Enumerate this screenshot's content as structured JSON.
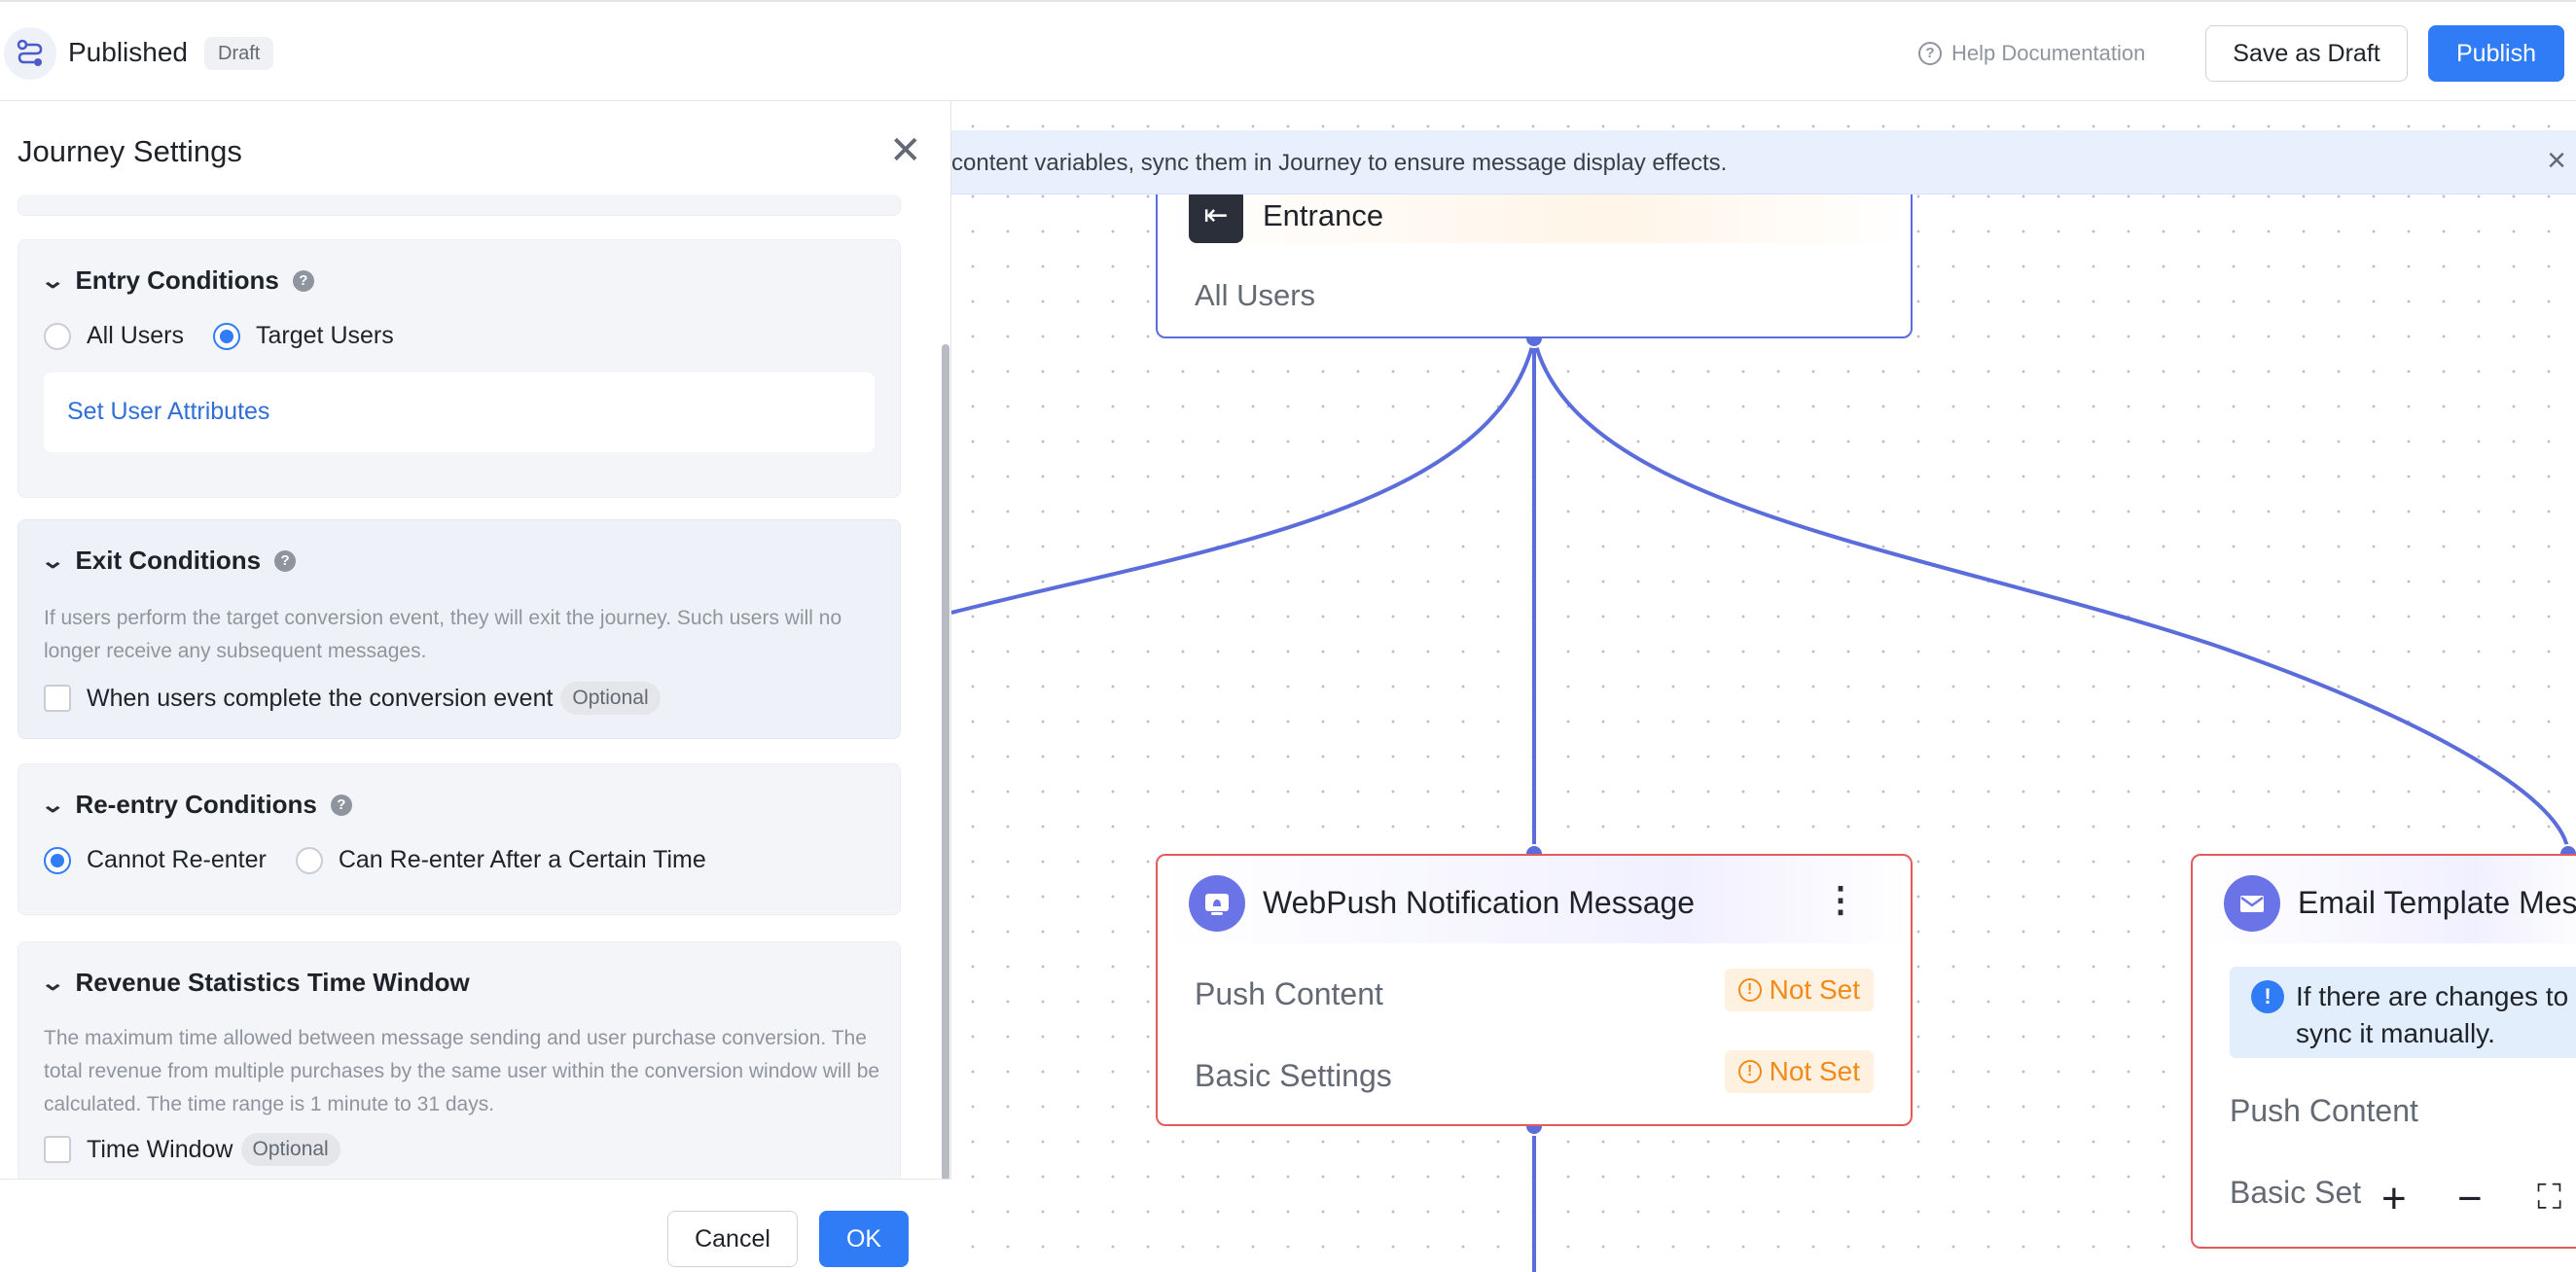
{
  "header": {
    "title": "Published",
    "status_badge": "Draft",
    "help_label": "Help Documentation",
    "save_draft_label": "Save as Draft",
    "publish_label": "Publish"
  },
  "banner": {
    "text": "content variables, sync them in Journey to ensure message display effects."
  },
  "canvas": {
    "entrance": {
      "title": "Entrance",
      "audience": "All Users"
    },
    "webpush": {
      "title": "WebPush Notification Message",
      "rows": [
        {
          "label": "Push Content",
          "status": "Not Set"
        },
        {
          "label": "Basic Settings",
          "status": "Not Set"
        }
      ]
    },
    "email": {
      "title": "Email Template Mes",
      "note_line1": "If there are changes to",
      "note_line2": "sync it manually.",
      "rows": [
        "Push Content",
        "Basic Set"
      ]
    },
    "zoom": {
      "in": "+",
      "out": "−",
      "fit": "⛶"
    }
  },
  "panel": {
    "title": "Journey Settings",
    "entry": {
      "heading": "Entry Conditions",
      "options": [
        "All Users",
        "Target Users"
      ],
      "selected": "Target Users",
      "set_attributes_link": "Set User Attributes"
    },
    "exit": {
      "heading": "Exit Conditions",
      "description": "If users perform the target conversion event, they will exit the journey. Such users will no longer receive any subsequent messages.",
      "checkbox_label": "When users complete the conversion event",
      "optional_tag": "Optional"
    },
    "reentry": {
      "heading": "Re-entry Conditions",
      "options": [
        "Cannot Re-enter",
        "Can Re-enter After a Certain Time"
      ],
      "selected": "Cannot Re-enter"
    },
    "revenue": {
      "heading": "Revenue Statistics Time Window",
      "description": "The maximum time allowed between message sending and user purchase conversion. The total revenue from multiple purchases by the same user within the conversion window will be calculated. The time range is 1 minute to 31 days.",
      "checkbox_label": "Time Window",
      "optional_tag": "Optional"
    },
    "footer": {
      "cancel_label": "Cancel",
      "ok_label": "OK"
    }
  },
  "colors": {
    "accent": "#2f7cf6",
    "flow_line": "#5b6cdb",
    "error_border": "#e55a5a",
    "warning": "#f08a18"
  }
}
